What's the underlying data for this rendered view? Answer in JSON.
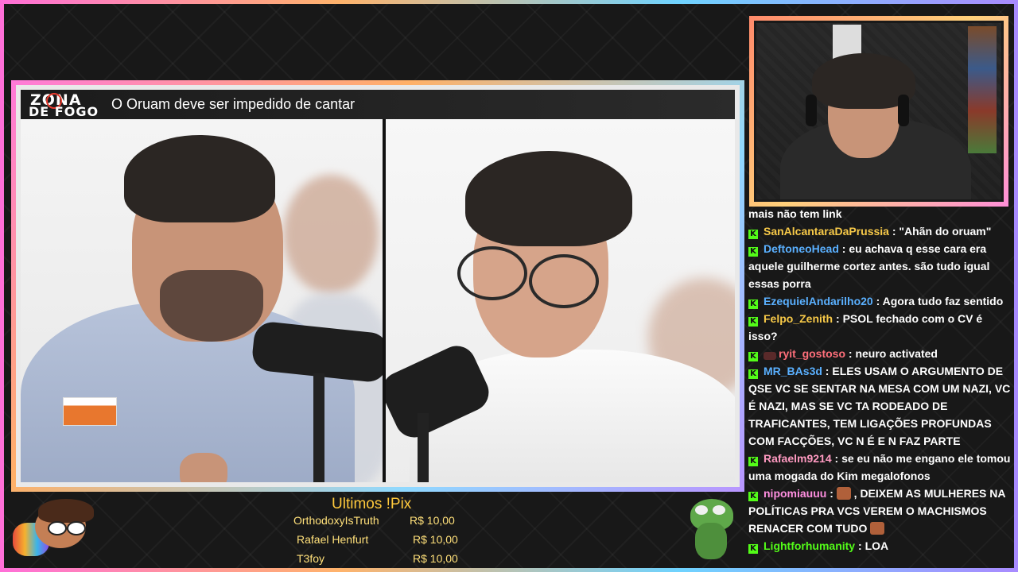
{
  "video": {
    "logo_line1": "ZONA",
    "logo_line2": "DE FOGO",
    "title": "O Oruam deve ser impedido de cantar"
  },
  "pix": {
    "title": "Ultimos !Pix",
    "entries": [
      {
        "name": "OrthodoxyIsTruth",
        "amount": "R$ 10,00"
      },
      {
        "name": "Rafael Henfurt",
        "amount": "R$ 10,00"
      },
      {
        "name": "T3foy",
        "amount": "R$ 10,00"
      }
    ]
  },
  "chat": {
    "badge_symbol": "K",
    "badge_color": "#53fc18",
    "messages": [
      {
        "user": "",
        "color": "#ffffff",
        "text": "mais não tem link",
        "continuation": true
      },
      {
        "user": "SanAlcantaraDaPrussia",
        "color": "#f7c948",
        "text": "\"Ahãn do oruam\""
      },
      {
        "user": "DeftoneoHead",
        "color": "#5ab0ff",
        "text": "eu achava q esse cara era aquele guilherme cortez antes. são tudo igual essas porra"
      },
      {
        "user": "EzequielAndarilho20",
        "color": "#5ab0ff",
        "text": "Agora tudo faz sentido"
      },
      {
        "user": "Felpo_Zenith",
        "color": "#f7c948",
        "text": "PSOL fechado com o CV é isso?"
      },
      {
        "user": "ryit_gostoso",
        "color": "#ff6f7a",
        "text": "neuro activated",
        "prefix_emote": true
      },
      {
        "user": "MR_BAs3d",
        "color": "#5ab0ff",
        "text": "ELES USAM O ARGUMENTO DE QSE VC SE SENTAR NA MESA COM UM NAZI, VC É NAZI, MAS SE VC TA RODEADO DE TRAFICANTES, TEM LIGAÇÕES PROFUNDAS COM FACÇÕES, VC N É E N FAZ PARTE"
      },
      {
        "user": "Rafaelm9214",
        "color": "#ff9ac1",
        "text": "se eu não me engano ele tomou uma mogada do Kim megalofonos"
      },
      {
        "user": "nipomiauuu",
        "color": "#ff8fe0",
        "text": ", DEIXEM AS MULHERES NA POLÍTICAS PRA VCS VEREM O MACHISMOS RENACER COM TUDO",
        "emotes": true
      },
      {
        "user": "Lightforhumanity",
        "color": "#53fc18",
        "text": "LOA"
      }
    ]
  }
}
